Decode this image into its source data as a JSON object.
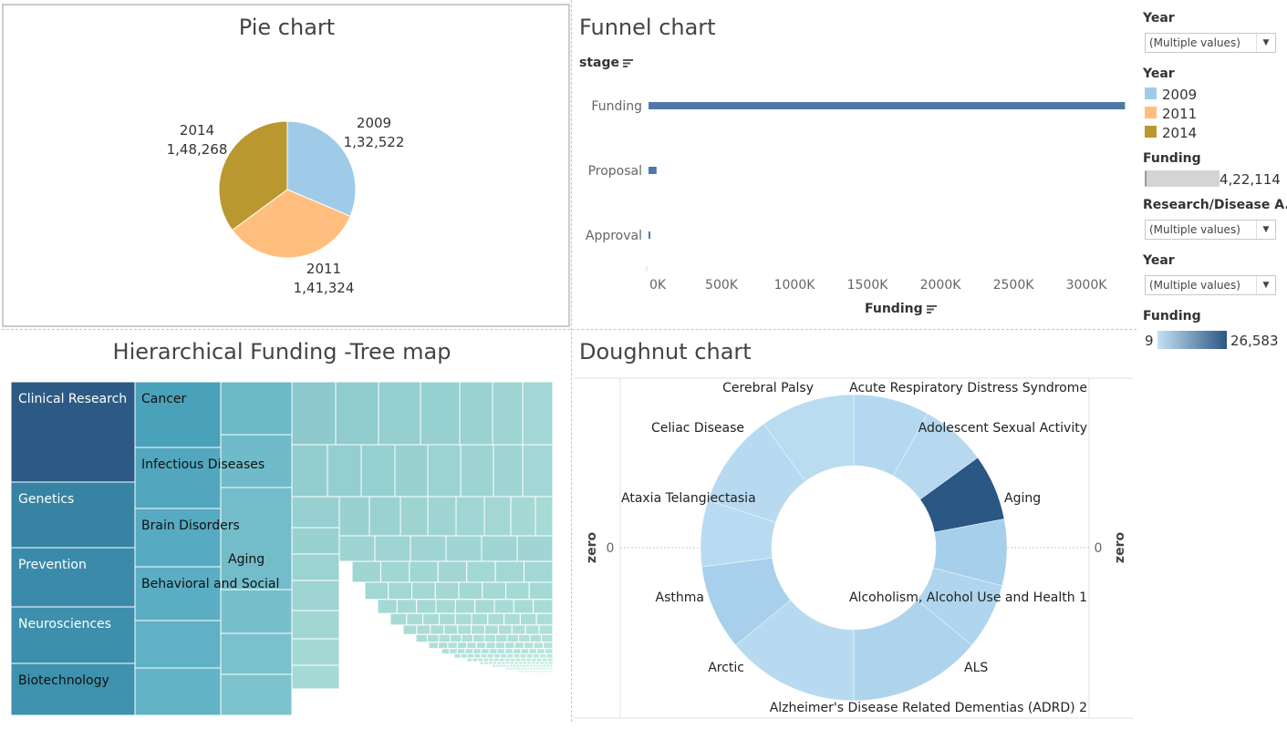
{
  "titles": {
    "pie": "Pie chart",
    "funnel": "Funnel chart",
    "treemap": "Hierarchical Funding -Tree map",
    "doughnut": "Doughnut chart"
  },
  "colors": {
    "y2009": "#a0cbe8",
    "y2011": "#ffbe7d",
    "y2014": "#b9982f",
    "funnel_bar": "#4e79a7"
  },
  "sidebar": {
    "year_filter_1": {
      "label": "Year",
      "value": "(Multiple values)"
    },
    "year_legend": {
      "label": "Year",
      "items": [
        "2009",
        "2011",
        "2014"
      ]
    },
    "funding_size": {
      "label": "Funding",
      "value": "4,22,114"
    },
    "research_filter": {
      "label": "Research/Disease A..",
      "value": "(Multiple values)"
    },
    "year_filter_2": {
      "label": "Year",
      "value": "(Multiple values)"
    },
    "funding_color": {
      "label": "Funding",
      "min": "9",
      "max": "26,583"
    }
  },
  "chart_data": [
    {
      "type": "pie",
      "title": "Pie chart",
      "slices": [
        {
          "label": "2009",
          "value": 132522,
          "display": "1,32,522"
        },
        {
          "label": "2011",
          "value": 141324,
          "display": "1,41,324"
        },
        {
          "label": "2014",
          "value": 148268,
          "display": "1,48,268"
        }
      ]
    },
    {
      "type": "bar",
      "title": "Funnel chart",
      "ylabel": "stage",
      "xlabel": "Funding",
      "categories": [
        "Funding",
        "Proposal",
        "Approval"
      ],
      "values": [
        3265000,
        55000,
        12000
      ],
      "xlim": [
        0,
        3300000
      ],
      "xticks": [
        0,
        500000,
        1000000,
        1500000,
        2000000,
        2500000,
        3000000
      ],
      "xtick_labels": [
        "0K",
        "500K",
        "1000K",
        "1500K",
        "2000K",
        "2500K",
        "3000K"
      ]
    },
    {
      "type": "treemap",
      "title": "Hierarchical Funding -Tree map",
      "labeled_items": [
        "Clinical Research",
        "Genetics",
        "Prevention",
        "Neurosciences",
        "Biotechnology",
        "Cancer",
        "Infectious Diseases",
        "Brain Disorders",
        "Behavioral and Social",
        "Aging"
      ]
    },
    {
      "type": "pie",
      "title": "Doughnut chart",
      "ylabel": "zero",
      "axis_value": "0",
      "slices": [
        {
          "label": "Acute Respiratory Distress Syndrome",
          "value": 8
        },
        {
          "label": "Adolescent Sexual Activity",
          "value": 7
        },
        {
          "label": "Aging",
          "value": 7
        },
        {
          "label": "Alcoholism, Alcohol Use and Health 1",
          "value": 7
        },
        {
          "label": "ALS",
          "value": 7
        },
        {
          "label": "Alzheimer's Disease Related Dementias (ADRD) 2",
          "value": 14
        },
        {
          "label": "Arctic",
          "value": 14
        },
        {
          "label": "Asthma",
          "value": 9
        },
        {
          "label": "Ataxia Telangiectasia",
          "value": 7
        },
        {
          "label": "Celiac Disease",
          "value": 10
        },
        {
          "label": "Cerebral Palsy",
          "value": 10
        }
      ]
    }
  ]
}
